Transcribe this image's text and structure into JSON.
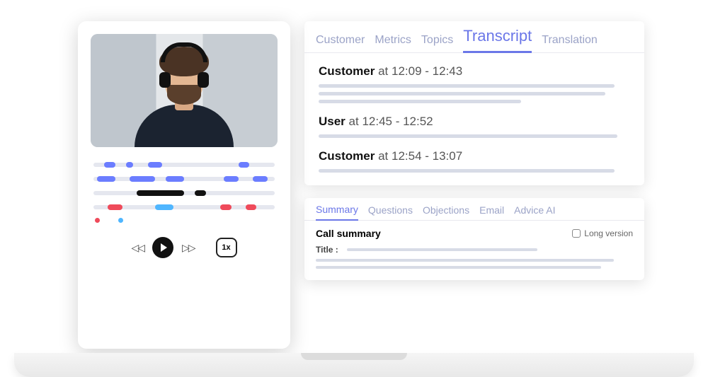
{
  "player": {
    "speed_label": "1x"
  },
  "transcript_tabs": [
    "Customer",
    "Metrics",
    "Topics",
    "Transcript",
    "Translation"
  ],
  "transcript_active_index": 3,
  "transcript_entries": [
    {
      "speaker": "Customer",
      "time": "at 12:09 - 12:43",
      "lines": [
        "w95",
        "w92",
        "w65"
      ]
    },
    {
      "speaker": "User",
      "time": "at 12:45 - 12:52",
      "lines": [
        "w96"
      ]
    },
    {
      "speaker": "Customer",
      "time": "at 12:54 - 13:07",
      "lines": [
        "w95"
      ]
    }
  ],
  "summary_tabs": [
    "Summary",
    "Questions",
    "Objections",
    "Email",
    "Advice AI"
  ],
  "summary_active_index": 0,
  "summary": {
    "heading": "Call summary",
    "long_label": "Long version",
    "title_label": "Title :"
  }
}
